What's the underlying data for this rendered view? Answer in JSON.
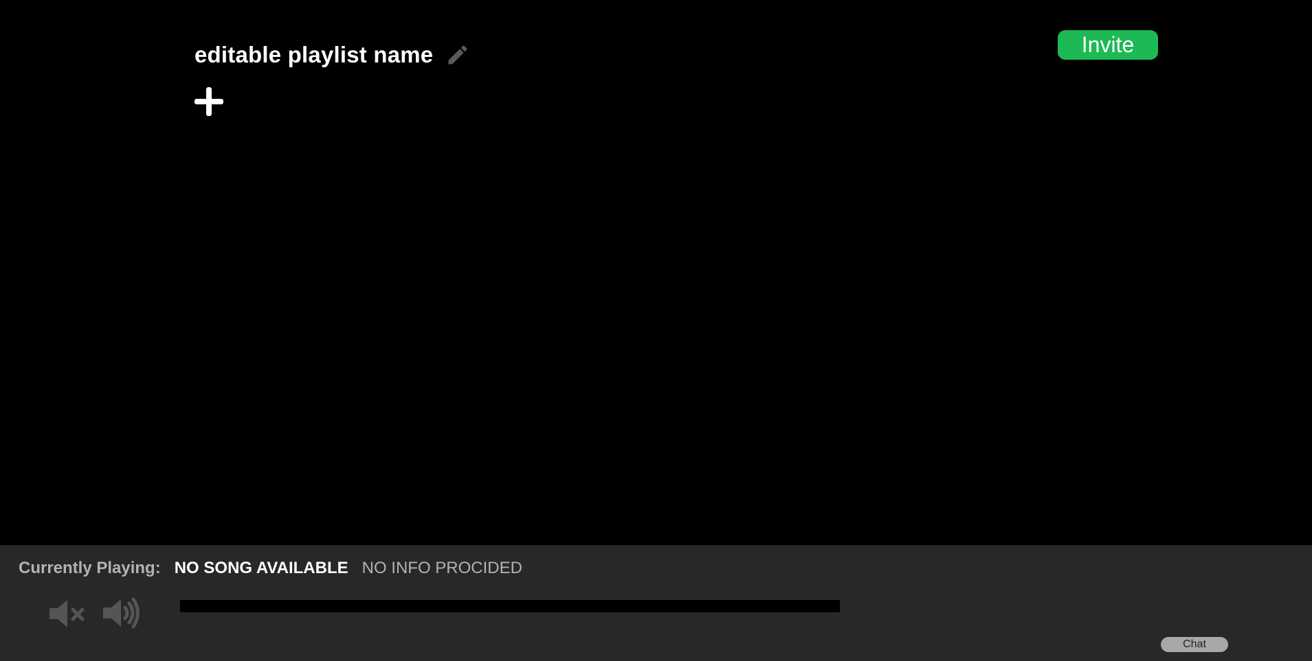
{
  "playlist": {
    "name": "editable playlist name",
    "edit_icon": "pencil-icon",
    "add_icon": "plus-icon"
  },
  "header": {
    "invite_label": "Invite"
  },
  "player": {
    "currently_playing_label": "Currently Playing:",
    "song_title": "NO SONG AVAILABLE",
    "song_info": "NO INFO PROCIDED",
    "mute_icon": "volume-mute-icon",
    "volume_icon": "volume-up-icon",
    "progress": 0,
    "chat_label": "Chat"
  },
  "colors": {
    "background": "#000000",
    "player_bar": "#282828",
    "accent": "#1db954",
    "muted_text": "#b3b3b3",
    "icon_gray": "#555555"
  }
}
